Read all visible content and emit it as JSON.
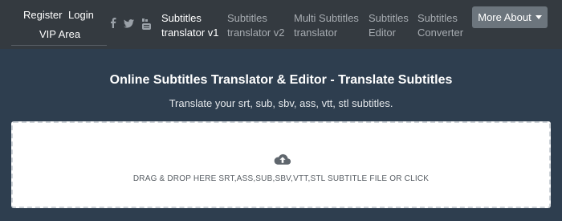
{
  "user_menu": {
    "register": "Register",
    "login": "Login",
    "vip": "VIP Area"
  },
  "social_icons": [
    "facebook-icon",
    "twitter-icon",
    "youtube-icon"
  ],
  "nav": [
    {
      "line1": "Subtitles",
      "line2": "translator v1",
      "active": true
    },
    {
      "line1": "Subtitles",
      "line2": "translator v2",
      "active": false
    },
    {
      "line1": "Multi Subtitles",
      "line2": "translator",
      "active": false
    },
    {
      "line1": "Subtitles",
      "line2": "Editor",
      "active": false
    },
    {
      "line1": "Subtitles",
      "line2": "Converter",
      "active": false
    }
  ],
  "more_about": "More About",
  "main": {
    "title": "Online Subtitles Translator & Editor - Translate Subtitles",
    "subtitle": "Translate your srt, sub, sbv, ass, vtt, stl subtitles.",
    "dropzone_text": "DRAG & DROP HERE SRT,ASS,SUB,SBV,VTT,STL SUBTITLE FILE OR CLICK"
  },
  "colors": {
    "topbar": "#343a40",
    "page": "#2e3e4f",
    "button": "#6c757d"
  }
}
